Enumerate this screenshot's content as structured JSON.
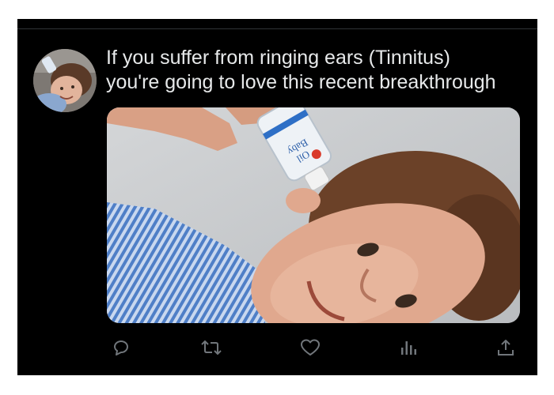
{
  "tweet": {
    "text_lines": [
      "If you suffer from ringing ears (Tinnitus)",
      "you're going to love this recent breakthrough"
    ],
    "media": {
      "bottle_label_line1": "Baby",
      "bottle_label_line2": "Oil"
    }
  },
  "actions": {
    "icons": [
      "reply-icon",
      "retweet-icon",
      "like-icon",
      "views-icon",
      "share-icon"
    ]
  },
  "colors": {
    "background": "#000000",
    "text": "#e7e9ea",
    "icon": "#71767b"
  }
}
